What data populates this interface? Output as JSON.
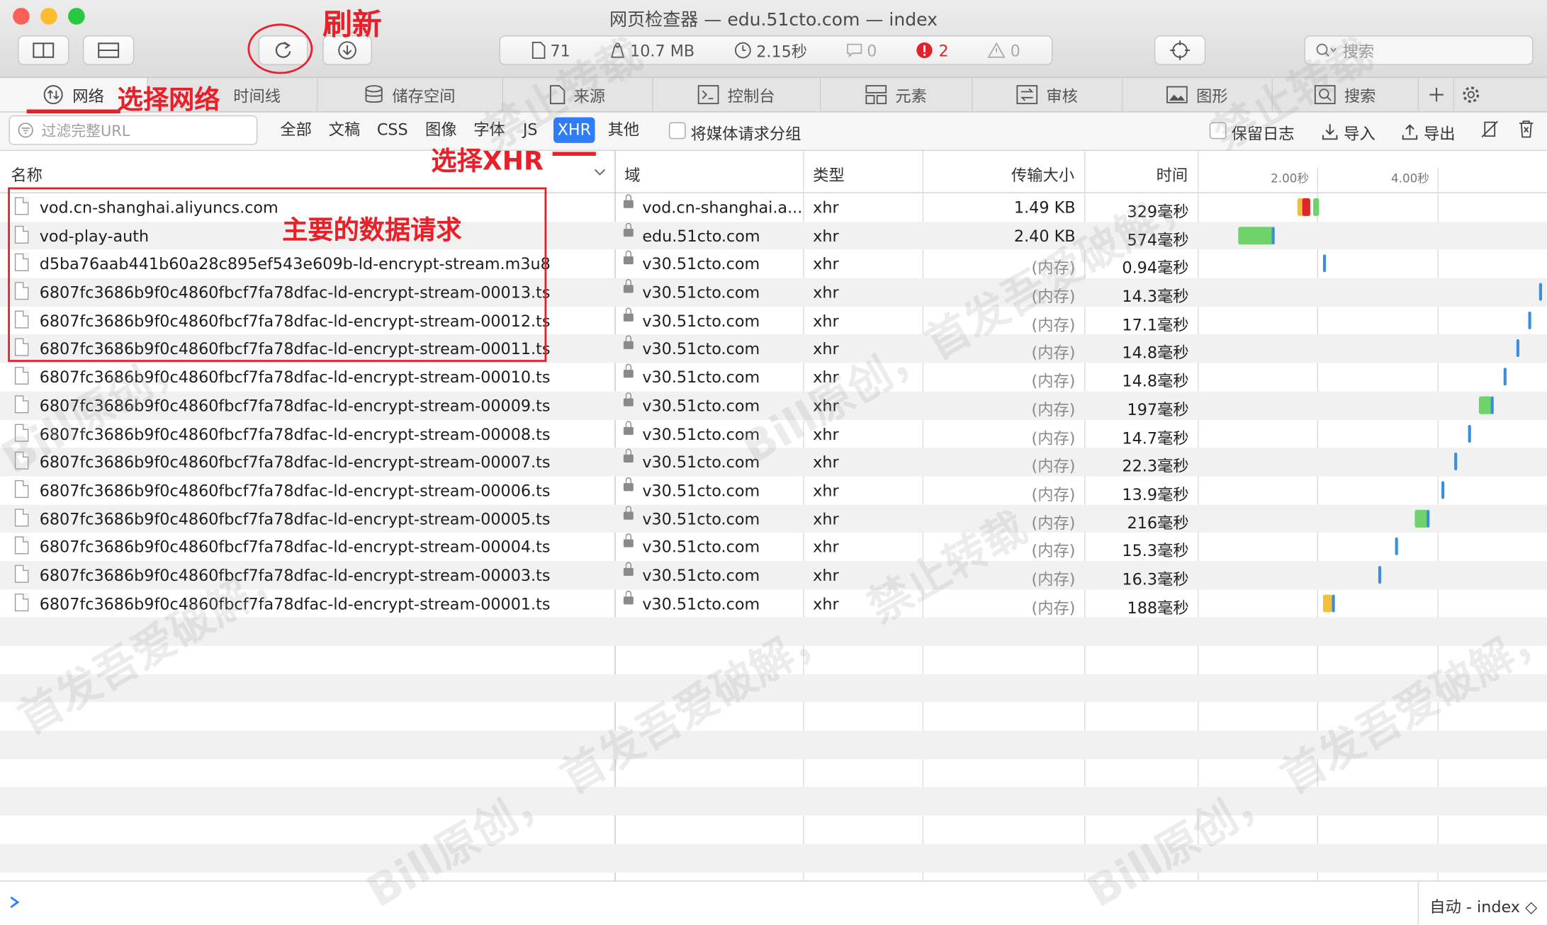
{
  "window": {
    "title": "网页检查器 — edu.51cto.com — index"
  },
  "toolbar": {
    "stats": {
      "resources": "71",
      "size": "10.7 MB",
      "time": "2.15秒",
      "messages": "0",
      "errors": "2",
      "warnings": "0"
    },
    "search_placeholder": "搜索"
  },
  "tabs": [
    {
      "label": "网络",
      "icon": "network-icon"
    },
    {
      "label": "时间线",
      "icon": "timeline-icon"
    },
    {
      "label": "储存空间",
      "icon": "storage-icon"
    },
    {
      "label": "来源",
      "icon": "sources-icon"
    },
    {
      "label": "控制台",
      "icon": "console-icon"
    },
    {
      "label": "元素",
      "icon": "elements-icon"
    },
    {
      "label": "审核",
      "icon": "audit-icon"
    },
    {
      "label": "图形",
      "icon": "graphics-icon"
    },
    {
      "label": "搜索",
      "icon": "search-icon"
    }
  ],
  "filter": {
    "placeholder": "过滤完整URL",
    "types": [
      "全部",
      "文稿",
      "CSS",
      "图像",
      "字体",
      "JS",
      "XHR",
      "其他"
    ],
    "selected": "XHR",
    "group_media": "将媒体请求分组",
    "preserve_log": "保留日志",
    "import": "导入",
    "export": "导出"
  },
  "table": {
    "headers": {
      "name": "名称",
      "domain": "域",
      "type": "类型",
      "size": "传输大小",
      "time": "时间"
    },
    "timeline_ticks": [
      "2.00秒",
      "4.00秒"
    ],
    "rows": [
      {
        "name": "vod.cn-shanghai.aliyuncs.com",
        "domain": "vod.cn-shanghai.a...",
        "type": "xhr",
        "size": "1.49 KB",
        "time": "329毫秒"
      },
      {
        "name": "vod-play-auth",
        "domain": "edu.51cto.com",
        "type": "xhr",
        "size": "2.40 KB",
        "time": "574毫秒"
      },
      {
        "name": "d5ba76aab441b60a28c895ef543e609b-ld-encrypt-stream.m3u8",
        "domain": "v30.51cto.com",
        "type": "xhr",
        "size": "(内存)",
        "time": "0.94毫秒"
      },
      {
        "name": "6807fc3686b9f0c4860fbcf7fa78dfac-ld-encrypt-stream-00013.ts",
        "domain": "v30.51cto.com",
        "type": "xhr",
        "size": "(内存)",
        "time": "14.3毫秒"
      },
      {
        "name": "6807fc3686b9f0c4860fbcf7fa78dfac-ld-encrypt-stream-00012.ts",
        "domain": "v30.51cto.com",
        "type": "xhr",
        "size": "(内存)",
        "time": "17.1毫秒"
      },
      {
        "name": "6807fc3686b9f0c4860fbcf7fa78dfac-ld-encrypt-stream-00011.ts",
        "domain": "v30.51cto.com",
        "type": "xhr",
        "size": "(内存)",
        "time": "14.8毫秒"
      },
      {
        "name": "6807fc3686b9f0c4860fbcf7fa78dfac-ld-encrypt-stream-00010.ts",
        "domain": "v30.51cto.com",
        "type": "xhr",
        "size": "(内存)",
        "time": "14.8毫秒"
      },
      {
        "name": "6807fc3686b9f0c4860fbcf7fa78dfac-ld-encrypt-stream-00009.ts",
        "domain": "v30.51cto.com",
        "type": "xhr",
        "size": "(内存)",
        "time": "197毫秒"
      },
      {
        "name": "6807fc3686b9f0c4860fbcf7fa78dfac-ld-encrypt-stream-00008.ts",
        "domain": "v30.51cto.com",
        "type": "xhr",
        "size": "(内存)",
        "time": "14.7毫秒"
      },
      {
        "name": "6807fc3686b9f0c4860fbcf7fa78dfac-ld-encrypt-stream-00007.ts",
        "domain": "v30.51cto.com",
        "type": "xhr",
        "size": "(内存)",
        "time": "22.3毫秒"
      },
      {
        "name": "6807fc3686b9f0c4860fbcf7fa78dfac-ld-encrypt-stream-00006.ts",
        "domain": "v30.51cto.com",
        "type": "xhr",
        "size": "(内存)",
        "time": "13.9毫秒"
      },
      {
        "name": "6807fc3686b9f0c4860fbcf7fa78dfac-ld-encrypt-stream-00005.ts",
        "domain": "v30.51cto.com",
        "type": "xhr",
        "size": "(内存)",
        "time": "216毫秒"
      },
      {
        "name": "6807fc3686b9f0c4860fbcf7fa78dfac-ld-encrypt-stream-00004.ts",
        "domain": "v30.51cto.com",
        "type": "xhr",
        "size": "(内存)",
        "time": "15.3毫秒"
      },
      {
        "name": "6807fc3686b9f0c4860fbcf7fa78dfac-ld-encrypt-stream-00003.ts",
        "domain": "v30.51cto.com",
        "type": "xhr",
        "size": "(内存)",
        "time": "16.3毫秒"
      },
      {
        "name": "6807fc3686b9f0c4860fbcf7fa78dfac-ld-encrypt-stream-00001.ts",
        "domain": "v30.51cto.com",
        "type": "xhr",
        "size": "(内存)",
        "time": "188毫秒"
      }
    ]
  },
  "bottom": {
    "context": "自动 - index ◇"
  },
  "annotations": {
    "refresh": "刷新",
    "select_network": "选择网络",
    "select_xhr": "选择XHR",
    "main_requests": "主要的数据请求"
  },
  "watermarks": [
    "Bill原创，",
    "首发吾爱破解，",
    "禁止转载"
  ],
  "colors": {
    "accent": "#2f7df6",
    "annotation": "#e8202a",
    "bar_green": "#6fd36b",
    "bar_blue": "#3b8ed8",
    "bar_yellow": "#f2c03a",
    "error": "#e0242d"
  }
}
